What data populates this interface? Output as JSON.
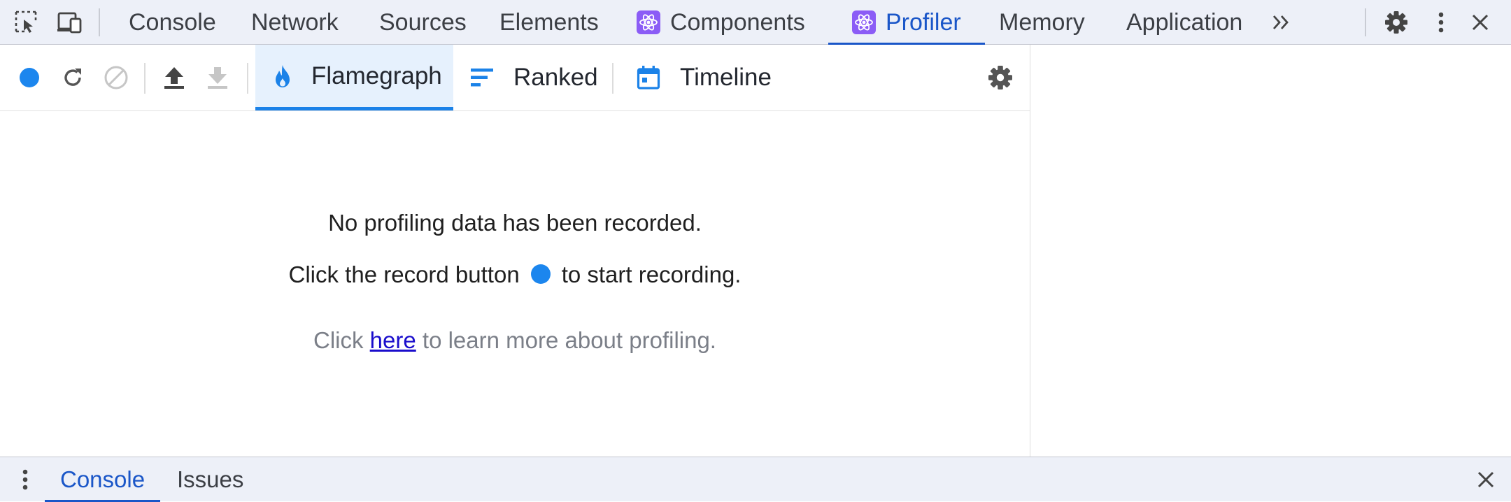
{
  "devtools": {
    "tabs": [
      {
        "label": "Console",
        "react": false
      },
      {
        "label": "Network",
        "react": false
      },
      {
        "label": "Sources",
        "react": false
      },
      {
        "label": "Elements",
        "react": false
      },
      {
        "label": "Components",
        "react": true
      },
      {
        "label": "Profiler",
        "react": true,
        "active": true
      },
      {
        "label": "Memory",
        "react": false
      },
      {
        "label": "Application",
        "react": false
      }
    ],
    "icons": [
      "inspect-element-icon",
      "device-toolbar-icon",
      "more-tabs-icon",
      "settings-icon",
      "kebab-menu-icon",
      "close-icon"
    ]
  },
  "profiler": {
    "toolbar": {
      "tabs": [
        {
          "label": "Flamegraph",
          "icon": "flame-icon",
          "active": true
        },
        {
          "label": "Ranked",
          "icon": "ranked-icon"
        },
        {
          "label": "Timeline",
          "icon": "calendar-icon"
        }
      ],
      "buttons": [
        "record-icon",
        "reload-icon",
        "clear-icon",
        "upload-icon",
        "download-icon",
        "settings-icon"
      ]
    },
    "empty_state": {
      "line1": "No profiling data has been recorded.",
      "line2_before": "Click the record button",
      "line2_after": "to start recording.",
      "line3_before": "Click",
      "line3_link": "here",
      "line3_after": "to learn more about profiling."
    }
  },
  "drawer": {
    "tabs": [
      {
        "label": "Console",
        "active": true
      },
      {
        "label": "Issues"
      }
    ]
  },
  "colors": {
    "accent_blue": "#1a56c8",
    "record_blue": "#1c86ee",
    "react_purple": "#8b5cf6",
    "chrome_bg": "#edf0f8"
  }
}
